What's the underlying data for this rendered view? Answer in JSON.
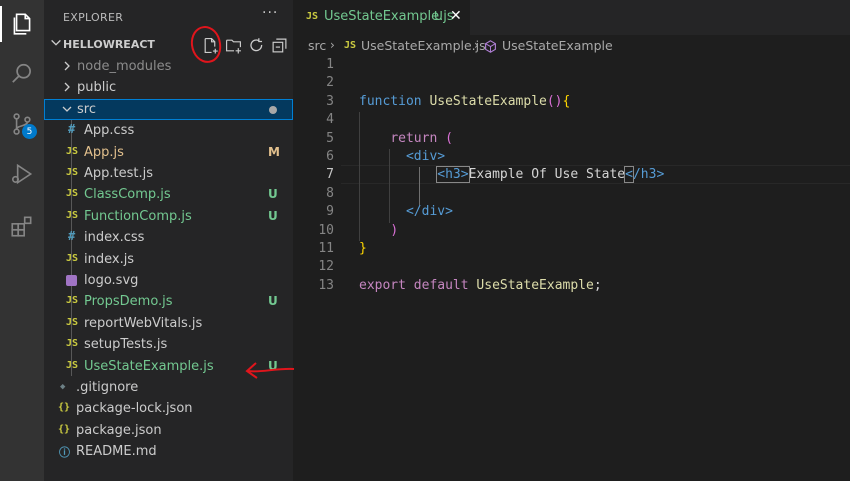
{
  "sidebar": {
    "title": "EXPLORER",
    "more": "···",
    "project": "HELLOWREACT",
    "tree": [
      {
        "label": "node_modules",
        "type": "folder-collapsed",
        "color": "#8c8c8c",
        "status": ""
      },
      {
        "label": "public",
        "type": "folder-collapsed",
        "color": "#cccccc",
        "status": ""
      },
      {
        "label": "src",
        "type": "folder-open",
        "color": "#cccccc",
        "status": "dot"
      },
      {
        "label": "App.css",
        "icon": "#",
        "icon_color": "#519aba",
        "color": "#cccccc",
        "status": ""
      },
      {
        "label": "App.js",
        "icon": "JS",
        "icon_color": "#cbcb41",
        "color": "#e2c08d",
        "status": "M"
      },
      {
        "label": "App.test.js",
        "icon": "JS",
        "icon_color": "#cbcb41",
        "color": "#cccccc",
        "status": ""
      },
      {
        "label": "ClassComp.js",
        "icon": "JS",
        "icon_color": "#cbcb41",
        "color": "#73c991",
        "status": "U"
      },
      {
        "label": "FunctionComp.js",
        "icon": "JS",
        "icon_color": "#cbcb41",
        "color": "#73c991",
        "status": "U"
      },
      {
        "label": "index.css",
        "icon": "#",
        "icon_color": "#519aba",
        "color": "#cccccc",
        "status": ""
      },
      {
        "label": "index.js",
        "icon": "JS",
        "icon_color": "#cbcb41",
        "color": "#cccccc",
        "status": ""
      },
      {
        "label": "logo.svg",
        "icon": "svg",
        "icon_color": "#a074c4",
        "color": "#cccccc",
        "status": ""
      },
      {
        "label": "PropsDemo.js",
        "icon": "JS",
        "icon_color": "#cbcb41",
        "color": "#73c991",
        "status": "U"
      },
      {
        "label": "reportWebVitals.js",
        "icon": "JS",
        "icon_color": "#cbcb41",
        "color": "#cccccc",
        "status": ""
      },
      {
        "label": "setupTests.js",
        "icon": "JS",
        "icon_color": "#cbcb41",
        "color": "#cccccc",
        "status": ""
      },
      {
        "label": "UseStateExample.js",
        "icon": "JS",
        "icon_color": "#cbcb41",
        "color": "#73c991",
        "status": "U"
      },
      {
        "label": ".gitignore",
        "icon": "◆",
        "icon_color": "#6d8086",
        "color": "#cccccc",
        "status": ""
      },
      {
        "label": "package-lock.json",
        "icon": "{}",
        "icon_color": "#cbcb41",
        "color": "#cccccc",
        "status": ""
      },
      {
        "label": "package.json",
        "icon": "{}",
        "icon_color": "#cbcb41",
        "color": "#cccccc",
        "status": ""
      },
      {
        "label": "README.md",
        "icon": "ⓘ",
        "icon_color": "#519aba",
        "color": "#cccccc",
        "status": ""
      }
    ]
  },
  "activity": {
    "source_control_badge": "5"
  },
  "tab": {
    "icon": "JS",
    "label": "UseStateExample.js",
    "status": "U",
    "close": "✕"
  },
  "breadcrumb": {
    "folder": "src",
    "file_icon": "JS",
    "file": "UseStateExample.js",
    "symbol": "UseStateExample"
  },
  "editor": {
    "active_line": 7,
    "line_numbers": [
      "1",
      "2",
      "3",
      "4",
      "5",
      "6",
      "7",
      "8",
      "9",
      "10",
      "11",
      "12",
      "13"
    ],
    "code": {
      "l3_kw": "function",
      "l3_fn": "UseStateExample",
      "l3_paren": "()",
      "l3_brace": "{",
      "l5_kw": "return",
      "l5_paren": "(",
      "l6_tag": "<div>",
      "l7_open": "<h3>",
      "l7_text": "Example Of Use State",
      "l7_close_lt": "<",
      "l7_close_rest": "/h3>",
      "l9_tag": "</div>",
      "l10_paren": ")",
      "l11_brace": "}",
      "l13_kw1": "export",
      "l13_kw2": "default",
      "l13_fn": "UseStateExample",
      "l13_semi": ";"
    }
  },
  "colors": {
    "accent": "#007acc",
    "untracked": "#73c991",
    "modified": "#e2c08d",
    "annotation": "#e0151c"
  }
}
